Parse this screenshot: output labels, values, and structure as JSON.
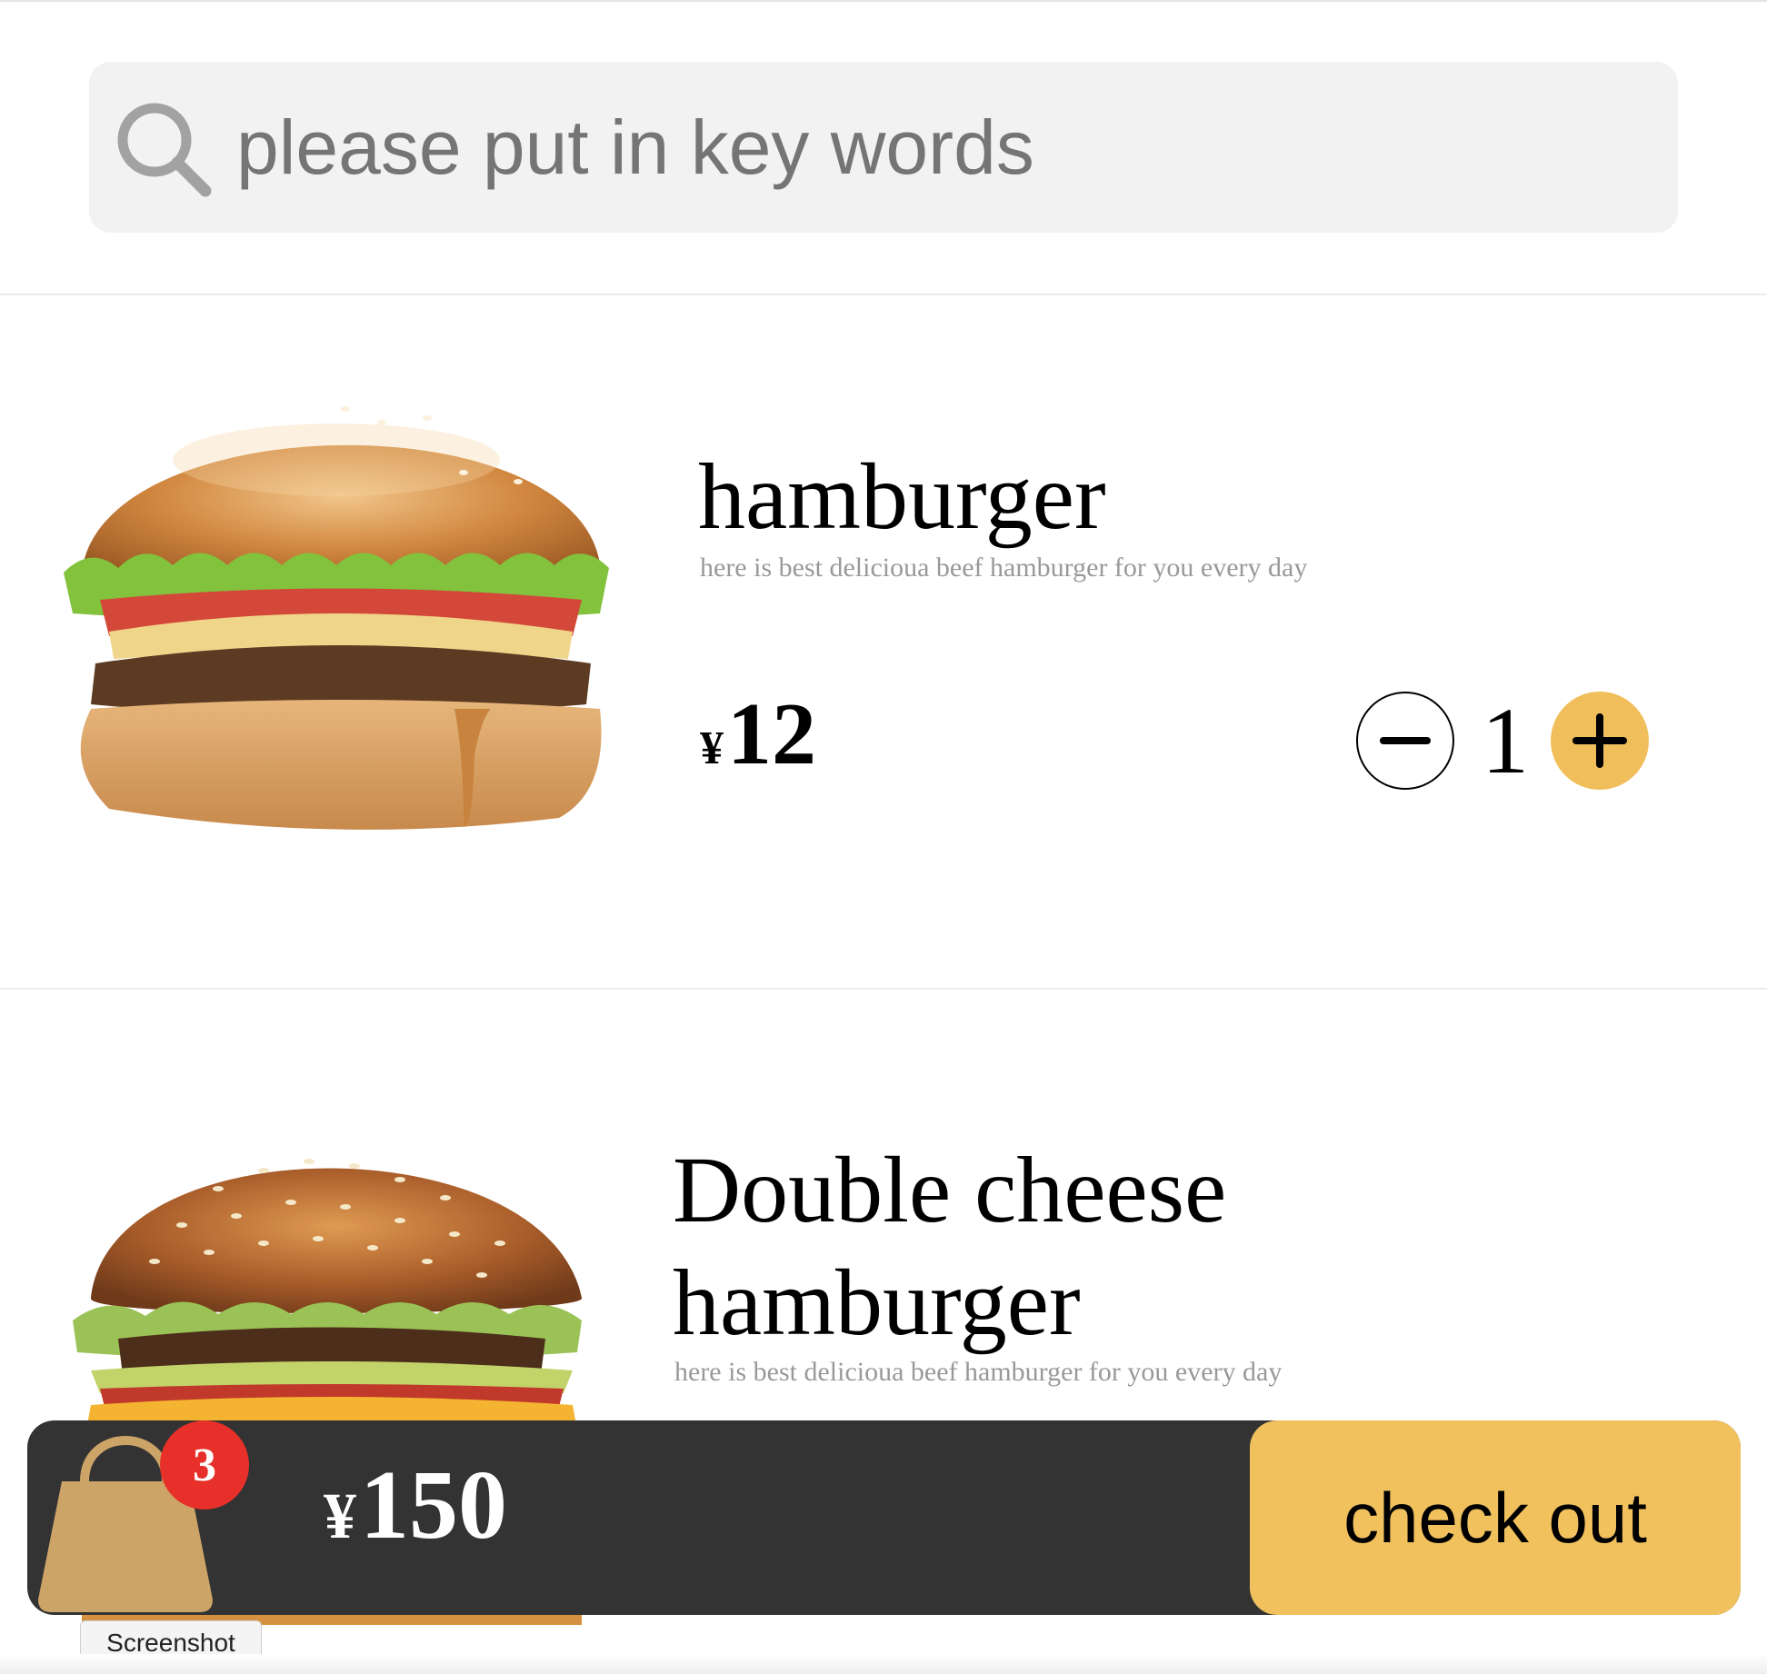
{
  "search": {
    "placeholder": "please put in key words"
  },
  "products": [
    {
      "name": "hamburger",
      "description": "here is best delicioua beef hamburger for you every day",
      "currency": "¥",
      "price": "12",
      "quantity": "1"
    },
    {
      "name": "Double cheese hamburger",
      "description": "here is best delicioua beef hamburger for you every day"
    }
  ],
  "cart": {
    "count": "3",
    "currency": "¥",
    "total": "150",
    "checkout_label": "check out"
  },
  "tooltip": {
    "label": "Screenshot"
  },
  "colors": {
    "accent": "#f0bf5c",
    "cart_bar": "#333333",
    "badge": "#e8302a",
    "bag": "#cda467"
  },
  "icons": {
    "search": "search-icon",
    "bag": "shopping-bag-icon",
    "minus": "minus-icon",
    "plus": "plus-icon"
  }
}
